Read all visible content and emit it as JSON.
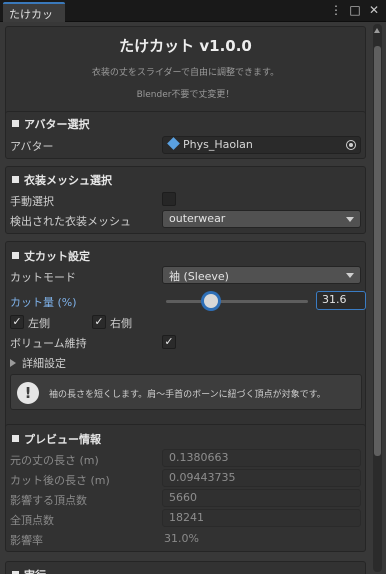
{
  "window": {
    "tab_label": "たけカット",
    "icons": [
      "menu-dots-icon",
      "maximize-icon",
      "close-icon"
    ]
  },
  "header": {
    "title": "たけカット v1.0.0",
    "subtitle1": "衣装の丈をスライダーで自由に調整できます。",
    "subtitle2": "Blender不要で丈変更！"
  },
  "avatar_section": {
    "title": "アバター選択",
    "avatar_label": "アバター",
    "avatar_value": "Phys_Haolan"
  },
  "mesh_section": {
    "title": "衣装メッシュ選択",
    "manual_label": "手動選択",
    "manual_checked": false,
    "detected_label": "検出された衣装メッシュ",
    "detected_value": "outerwear"
  },
  "cut_section": {
    "title": "丈カット設定",
    "mode_label": "カットモード",
    "mode_value": "袖 (Sleeve)",
    "amount_label": "カット量 (%)",
    "amount_value": "31.6",
    "amount_fraction": 0.316,
    "left_label": "左側",
    "left_checked": true,
    "right_label": "右側",
    "right_checked": true,
    "volume_label": "ボリューム維持",
    "volume_checked": true,
    "advanced_label": "詳細設定",
    "check_glyph": "✓",
    "help_glyph": "!",
    "help_text": "袖の長さを短くします。肩～手首のボーンに紐づく頂点が対象です。"
  },
  "preview_section": {
    "title": "プレビュー情報",
    "rows": [
      {
        "label": "元の丈の長さ (m)",
        "value": "0.1380663"
      },
      {
        "label": "カット後の長さ (m)",
        "value": "0.09443735"
      },
      {
        "label": "影響する頂点数",
        "value": "5660"
      },
      {
        "label": "全頂点数",
        "value": "18241"
      }
    ],
    "ratio_label": "影響率",
    "ratio_value": "31.0%"
  },
  "exec_section": {
    "title": "実行"
  }
}
